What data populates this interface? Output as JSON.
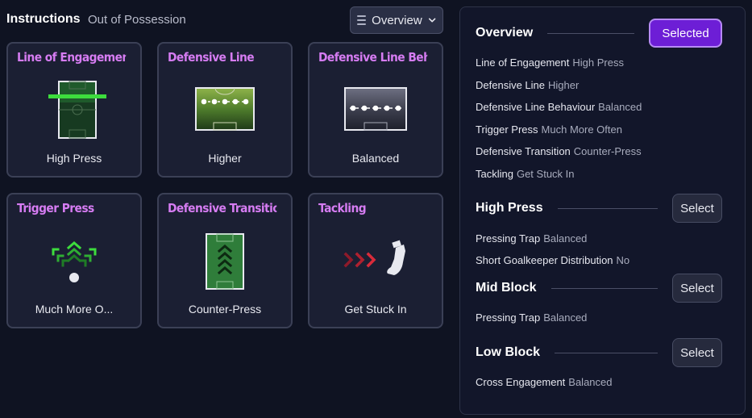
{
  "header": {
    "title": "Instructions",
    "subtitle": "Out of Possession",
    "view_dropdown": "Overview"
  },
  "cards": [
    {
      "title": "Line of Engagement",
      "value": "High Press",
      "icon": "pitch-line-icon"
    },
    {
      "title": "Defensive Line",
      "value": "Higher",
      "icon": "defensive-line-icon"
    },
    {
      "title": "Defensive Line Behaviour",
      "value": "Balanced",
      "icon": "line-behaviour-icon"
    },
    {
      "title": "Trigger Press",
      "value": "Much More O...",
      "icon": "trigger-press-icon"
    },
    {
      "title": "Defensive Transition",
      "value": "Counter-Press",
      "icon": "counter-press-icon"
    },
    {
      "title": "Tackling",
      "value": "Get Stuck In",
      "icon": "boot-tackle-icon"
    }
  ],
  "overview": {
    "title": "Overview",
    "button": "Selected",
    "items": [
      {
        "key": "Line of Engagement",
        "value": "High Press"
      },
      {
        "key": "Defensive Line",
        "value": "Higher"
      },
      {
        "key": "Defensive Line Behaviour",
        "value": "Balanced"
      },
      {
        "key": "Trigger Press",
        "value": "Much More Often"
      },
      {
        "key": "Defensive Transition",
        "value": "Counter-Press"
      },
      {
        "key": "Tackling",
        "value": "Get Stuck In"
      }
    ]
  },
  "high_press": {
    "title": "High Press",
    "button": "Select",
    "items": [
      {
        "key": "Pressing Trap",
        "value": "Balanced"
      },
      {
        "key": "Short Goalkeeper Distribution",
        "value": "No"
      }
    ]
  },
  "mid_block": {
    "title": "Mid Block",
    "button": "Select",
    "items": [
      {
        "key": "Pressing Trap",
        "value": "Balanced"
      }
    ]
  },
  "low_block": {
    "title": "Low Block",
    "button": "Select",
    "items": [
      {
        "key": "Cross Engagement",
        "value": "Balanced"
      }
    ]
  },
  "colors": {
    "background": "#0f1322",
    "card_title": "#d67cf2",
    "accent": "#6d1ed6",
    "pitch_green": "#2f7d3a",
    "press_line": "#3ddc3d",
    "tackle_red": "#c8243a"
  }
}
